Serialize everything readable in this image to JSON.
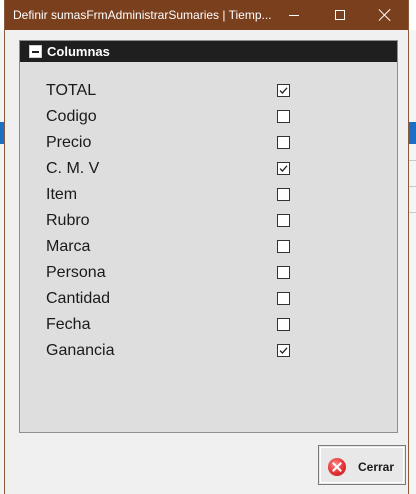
{
  "window": {
    "title": "Definir sumasFrmAdministrarSumaries | Tiemp...",
    "title_bar_color": "#7a3f1d",
    "controls": {
      "minimize": "minimize-icon",
      "maximize": "maximize-icon",
      "close": "close-icon"
    }
  },
  "group": {
    "title": "Columnas",
    "collapse_icon": "minus-icon",
    "items": [
      {
        "label": "TOTAL",
        "checked": true
      },
      {
        "label": "Codigo",
        "checked": false
      },
      {
        "label": "Precio",
        "checked": false
      },
      {
        "label": "C. M. V",
        "checked": true
      },
      {
        "label": "Item",
        "checked": false
      },
      {
        "label": "Rubro",
        "checked": false
      },
      {
        "label": "Marca",
        "checked": false
      },
      {
        "label": "Persona",
        "checked": false
      },
      {
        "label": "Cantidad",
        "checked": false
      },
      {
        "label": "Fecha",
        "checked": false
      },
      {
        "label": "Ganancia",
        "checked": true
      }
    ]
  },
  "footer": {
    "close_button_label": "Cerrar",
    "close_button_icon": "cancel-icon"
  }
}
